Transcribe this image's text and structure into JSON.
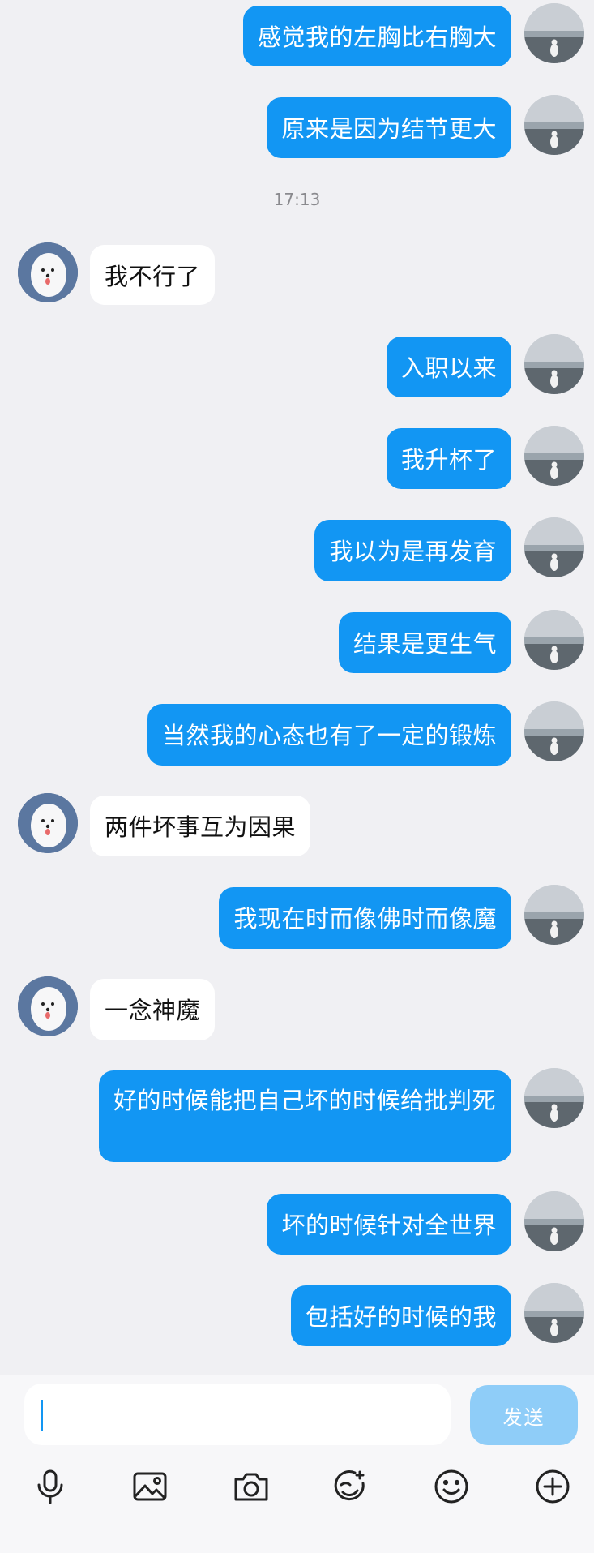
{
  "messages": [
    {
      "side": "me",
      "text": "感觉我的左胸比右胸大",
      "avatar": "beach-photo-avatar"
    },
    {
      "side": "me",
      "text": "原来是因为结节更大",
      "avatar": "beach-photo-avatar"
    },
    {
      "type": "time",
      "text": "17:13"
    },
    {
      "side": "them",
      "text": "我不行了",
      "avatar": "white-dog-avatar"
    },
    {
      "side": "me",
      "text": "入职以来",
      "avatar": "beach-photo-avatar"
    },
    {
      "side": "me",
      "text": "我升杯了",
      "avatar": "beach-photo-avatar"
    },
    {
      "side": "me",
      "text": "我以为是再发育",
      "avatar": "beach-photo-avatar"
    },
    {
      "side": "me",
      "text": "结果是更生气",
      "avatar": "beach-photo-avatar"
    },
    {
      "side": "me",
      "text": "当然我的心态也有了一定的锻炼",
      "avatar": "beach-photo-avatar"
    },
    {
      "side": "them",
      "text": "两件坏事互为因果",
      "avatar": "white-dog-avatar"
    },
    {
      "side": "me",
      "text": "我现在时而像佛时而像魔",
      "avatar": "beach-photo-avatar"
    },
    {
      "side": "them",
      "text": "一念神魔",
      "avatar": "white-dog-avatar"
    },
    {
      "side": "me",
      "text": "好的时候能把自己坏的时候给批判死",
      "avatar": "beach-photo-avatar"
    },
    {
      "side": "me",
      "text": "坏的时候针对全世界",
      "avatar": "beach-photo-avatar"
    },
    {
      "side": "me",
      "text": "包括好的时候的我",
      "avatar": "beach-photo-avatar"
    }
  ],
  "composer": {
    "input_value": "",
    "send_label": "发送"
  },
  "toolbar": [
    {
      "icon": "microphone-icon"
    },
    {
      "icon": "image-icon"
    },
    {
      "icon": "camera-icon"
    },
    {
      "icon": "sticker-icon"
    },
    {
      "icon": "emoji-icon"
    },
    {
      "icon": "plus-circle-icon"
    }
  ],
  "colors": {
    "background": "#f0f0f3",
    "my_bubble": "#1296f3",
    "their_bubble": "#ffffff",
    "send_button": "#8fcdf8",
    "timestamp": "#8a8a8e"
  }
}
